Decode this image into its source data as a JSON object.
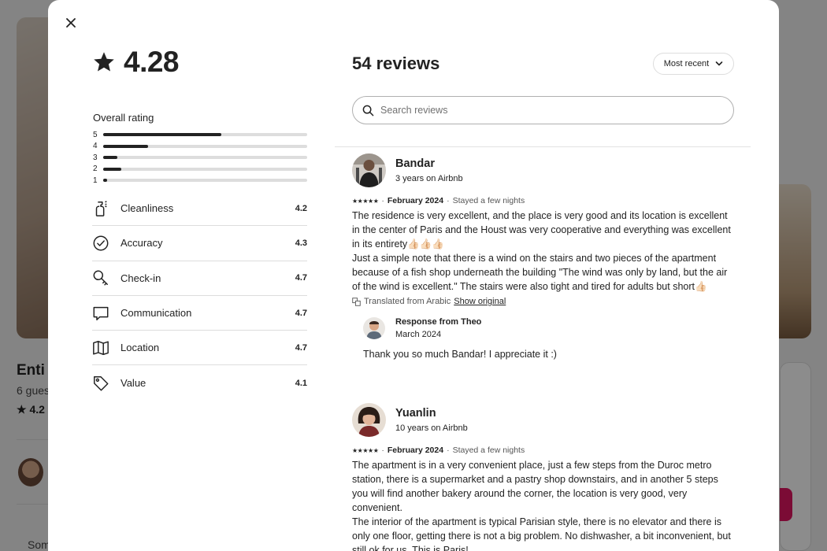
{
  "background": {
    "title": "Enti",
    "subtitle": "6 gues",
    "rating": "4.2",
    "footer_text": "Som"
  },
  "modal": {
    "close_icon": "close-icon",
    "rating": {
      "value": "4.28",
      "icon": "star-icon"
    },
    "overall": {
      "label": "Overall rating",
      "distribution": [
        {
          "stars": "5",
          "fraction": 0.58
        },
        {
          "stars": "4",
          "fraction": 0.22
        },
        {
          "stars": "3",
          "fraction": 0.07
        },
        {
          "stars": "2",
          "fraction": 0.09
        },
        {
          "stars": "1",
          "fraction": 0.02
        }
      ]
    },
    "categories": [
      {
        "label": "Cleanliness",
        "value": "4.2",
        "icon": "spray-bottle-icon"
      },
      {
        "label": "Accuracy",
        "value": "4.3",
        "icon": "check-circle-icon"
      },
      {
        "label": "Check-in",
        "value": "4.7",
        "icon": "key-icon"
      },
      {
        "label": "Communication",
        "value": "4.7",
        "icon": "chat-bubble-icon"
      },
      {
        "label": "Location",
        "value": "4.7",
        "icon": "map-icon"
      },
      {
        "label": "Value",
        "value": "4.1",
        "icon": "tag-icon"
      }
    ],
    "reviews_header": {
      "title": "54 reviews",
      "sort_label": "Most recent",
      "search_placeholder": "Search reviews"
    },
    "reviews": [
      {
        "name": "Bandar",
        "tenure": "3 years on Airbnb",
        "stars": "★★★★★",
        "date": "February 2024",
        "stay": "Stayed a few nights",
        "text": "The residence is very excellent, and the place is very good and its location is excellent in the center of Paris and the Houst was very cooperative and everything was excellent in its entirety👍🏻👍🏻👍🏻\nJust a simple note that there is a wind on the stairs and two pieces of the apartment because of a fish shop underneath the building \"The wind was only by land, but the air of the wind is excellent.\" The stairs were also tight and tired for adults but short👍🏻",
        "translated_label": "Translated from Arabic",
        "show_original_label": "Show original",
        "response": {
          "title": "Response from Theo",
          "date": "March 2024",
          "text": "Thank you so much Bandar! I appreciate it :)"
        }
      },
      {
        "name": "Yuanlin",
        "tenure": "10 years on Airbnb",
        "stars": "★★★★★",
        "date": "February 2024",
        "stay": "Stayed a few nights",
        "text": "The apartment is in a very convenient place, just a few steps from the Duroc metro station, there is a supermarket and a pastry shop downstairs, and in another 5 steps you will find another bakery around the corner, the location is very good, very convenient.\nThe interior of the apartment is typical Parisian style, there is no elevator and there is only one floor, getting there is not a big problem. No dishwasher, a bit inconvenient, but still ok for us. This is Paris!"
      }
    ],
    "separator": "·"
  }
}
